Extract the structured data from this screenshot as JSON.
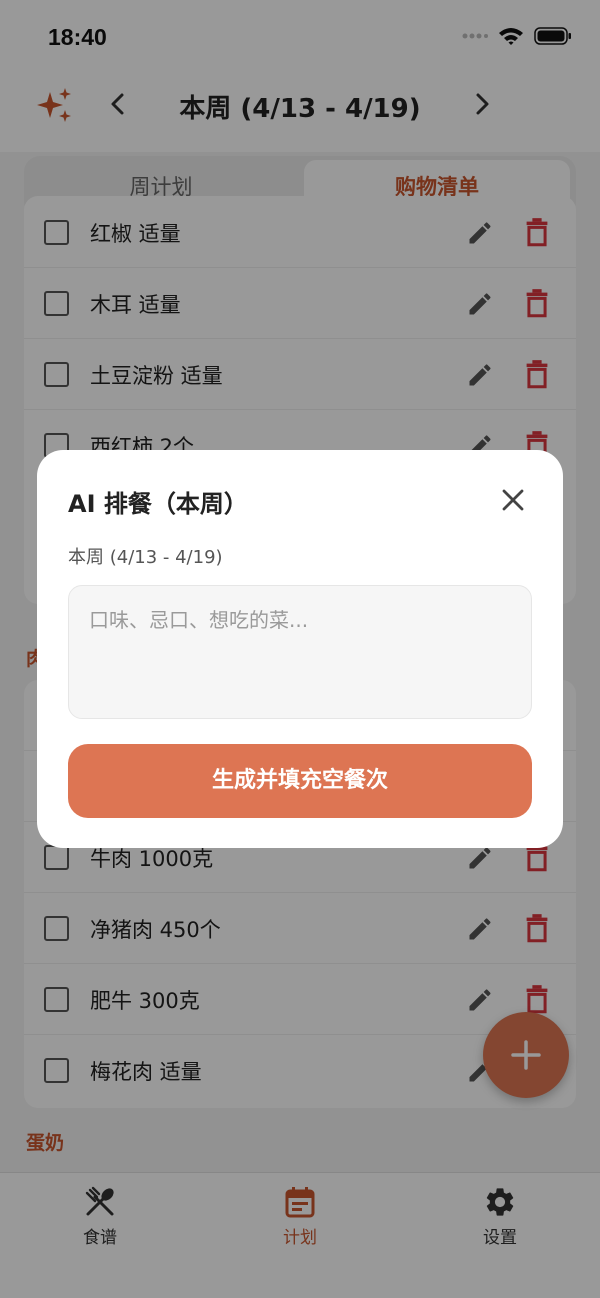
{
  "status": {
    "time": "18:40"
  },
  "header": {
    "title": "本周 (4/13 - 4/19)"
  },
  "segment": {
    "tab_plan": "周计划",
    "tab_shopping": "购物清单"
  },
  "shopping": {
    "top_items": [
      "红椒 适量",
      "木耳 适量",
      "土豆淀粉 适量",
      "西红柿 2个"
    ],
    "meat_section": "肉",
    "meat_items": [
      "牛肉 1000克",
      "净猪肉 450个",
      "肥牛 300克",
      "梅花肉 适量"
    ],
    "egg_section": "蛋奶"
  },
  "tabbar": {
    "recipes": "食谱",
    "plan": "计划",
    "settings": "设置"
  },
  "modal": {
    "title": "AI 排餐（本周）",
    "subtitle": "本周 (4/13 - 4/19)",
    "placeholder": "口味、忌口、想吃的菜...",
    "button": "生成并填充空餐次"
  },
  "colors": {
    "accent": "#dd7553",
    "accent_text": "#c8562e",
    "danger": "#d9363e"
  }
}
